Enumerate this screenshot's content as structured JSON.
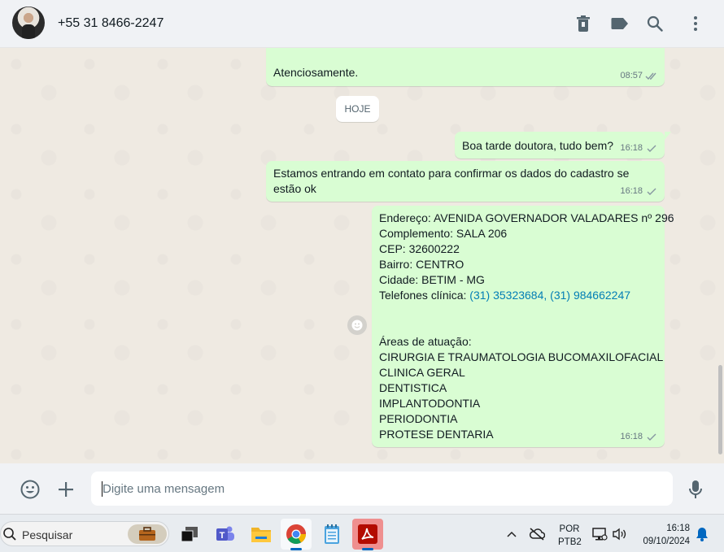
{
  "header": {
    "contact_name": "+55 31 8466-2247",
    "icons": [
      "delete-icon",
      "label-icon",
      "search-icon",
      "menu-icon"
    ]
  },
  "messages": [
    {
      "id": "m1",
      "text": "Atenciosamente.",
      "time": "08:57",
      "status": "read"
    },
    {
      "id": "m2",
      "text": "Boa tarde doutora, tudo bem?",
      "time": "16:18",
      "status": "sent"
    },
    {
      "id": "m3",
      "text": "Estamos entrando em contato para confirmar os dados do cadastro se estão ok",
      "time": "16:18",
      "status": "sent"
    },
    {
      "id": "m4",
      "time": "16:18",
      "status": "sent",
      "lines": {
        "address": "Endereço: AVENIDA GOVERNADOR VALADARES nº 296",
        "complement": "Complemento: SALA 206",
        "cep": "CEP: 32600222",
        "district": "Bairro: CENTRO",
        "city": "Cidade: BETIM - MG",
        "phones_label": "Telefones clínica: ",
        "phone1": "(31) 35323684",
        "phone_sep": ", ",
        "phone2": "(31) 984662247",
        "areas_label": "Áreas de atuação:",
        "area1": "CIRURGIA E TRAUMATOLOGIA BUCOMAXILOFACIAL",
        "area2": "CLINICA GERAL",
        "area3": "DENTISTICA",
        "area4": "IMPLANTODONTIA",
        "area5": "PERIODONTIA",
        "area6": "PROTESE DENTARIA"
      }
    }
  ],
  "day_separator": "HOJE",
  "composer": {
    "placeholder": "Digite uma mensagem"
  },
  "taskbar": {
    "search_label": "Pesquisar",
    "lang_top": "POR",
    "lang_bottom": "PTB2",
    "time": "16:18",
    "date": "09/10/2024"
  },
  "colors": {
    "outgoing_bubble": "#d9fdd3",
    "link": "#027eb5",
    "header_bg": "#f0f2f5",
    "chat_bg": "#efeae2"
  }
}
